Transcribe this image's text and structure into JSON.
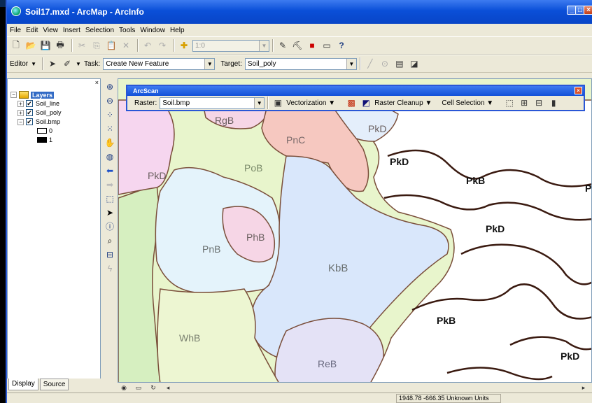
{
  "window": {
    "title": "Soil17.mxd - ArcMap - ArcInfo"
  },
  "menu": [
    "File",
    "Edit",
    "View",
    "Insert",
    "Selection",
    "Tools",
    "Window",
    "Help"
  ],
  "standard_toolbar": {
    "scale_value": "1:0"
  },
  "editor_toolbar": {
    "editor_label": "Editor",
    "task_label": "Task:",
    "task_value": "Create New Feature",
    "target_label": "Target:",
    "target_value": "Soil_poly"
  },
  "toc": {
    "root": "Layers",
    "layers": [
      {
        "name": "Soil_line",
        "checked": true,
        "expanded": false
      },
      {
        "name": "Soil_poly",
        "checked": true,
        "expanded": false
      },
      {
        "name": "Soil.bmp",
        "checked": true,
        "expanded": true
      }
    ],
    "legend": [
      {
        "label": "0",
        "color": "#ffffff"
      },
      {
        "label": "1",
        "color": "#000000"
      }
    ],
    "tabs": [
      "Display",
      "Source"
    ]
  },
  "arcscan": {
    "title": "ArcScan",
    "raster_label": "Raster:",
    "raster_value": "Soil.bmp",
    "menus": [
      "Vectorization",
      "Raster Cleanup",
      "Cell Selection"
    ]
  },
  "map_labels": [
    "RgB",
    "PkD",
    "PnC",
    "PkD",
    "PoB",
    "PkD",
    "PkB",
    "P",
    "PhB",
    "PnB",
    "PkD",
    "KbB",
    "PkB",
    "WhB",
    "ReB",
    "PkD"
  ],
  "status": {
    "coordinates": "1948.78  -666.35 Unknown Units"
  },
  "colors": {
    "title_bar": "#0a4fd8",
    "panel": "#ece9d8",
    "soil_green": "#e8f5cc",
    "soil_blue": "#d9e7fb",
    "soil_pink": "#f6d6e6",
    "soil_salmon": "#f6c8c0",
    "soil_lavender": "#e4e2f6",
    "soil_border": "#7a4e3a"
  }
}
